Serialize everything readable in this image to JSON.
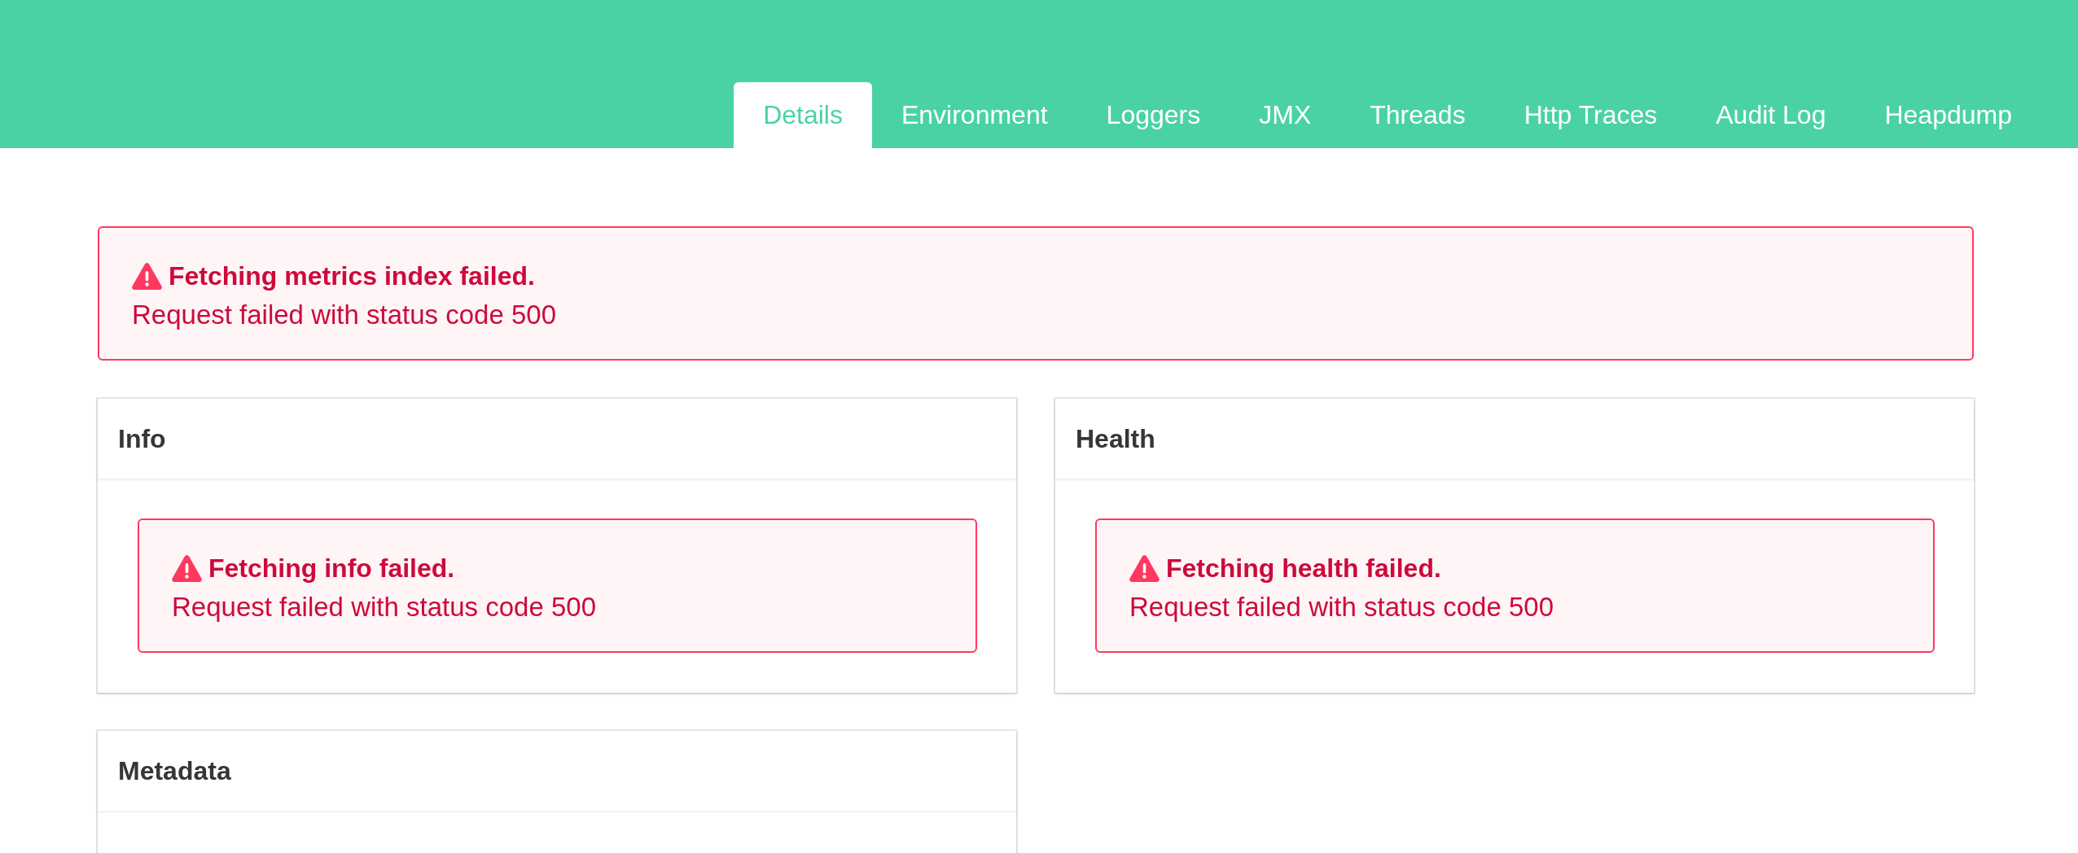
{
  "header": {
    "tabs": [
      {
        "label": "Details",
        "selected": true
      },
      {
        "label": "Environment",
        "selected": false
      },
      {
        "label": "Loggers",
        "selected": false
      },
      {
        "label": "JMX",
        "selected": false
      },
      {
        "label": "Threads",
        "selected": false
      },
      {
        "label": "Http Traces",
        "selected": false
      },
      {
        "label": "Audit Log",
        "selected": false
      },
      {
        "label": "Heapdump",
        "selected": false
      }
    ]
  },
  "alert": {
    "title": "Fetching metrics index failed.",
    "message": "Request failed with status code 500"
  },
  "cards": [
    {
      "title": "Info",
      "alert": {
        "title": "Fetching info failed.",
        "message": "Request failed with status code 500"
      }
    },
    {
      "title": "Health",
      "alert": {
        "title": "Fetching health failed.",
        "message": "Request failed with status code 500"
      }
    },
    {
      "title": "Metadata"
    }
  ]
}
